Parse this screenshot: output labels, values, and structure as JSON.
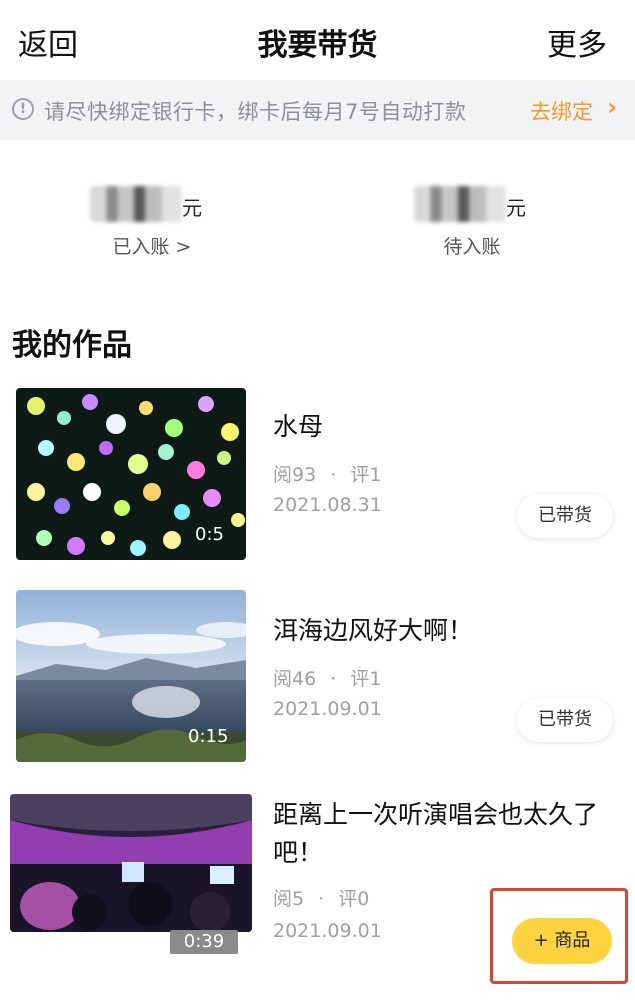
{
  "header": {
    "back_label": "返回",
    "title": "我要带货",
    "more_label": "更多"
  },
  "notice": {
    "icon": "info-circle-icon",
    "message": "请尽快绑定银行卡，绑卡后每月7号自动打款",
    "action_label": "去绑定",
    "accent_color": "#f39b2f"
  },
  "balances": [
    {
      "unit": "元",
      "label": "已入账 >"
    },
    {
      "unit": "元",
      "label": "待入账"
    }
  ],
  "section": {
    "title": "我的作品"
  },
  "works": [
    {
      "title": "水母",
      "views": "阅93",
      "sep": "·",
      "comments": "评1",
      "date": "2021.08.31",
      "duration": "0:5",
      "button_label": "已带货"
    },
    {
      "title": "洱海边风好大啊！",
      "views": "阅46",
      "sep": "·",
      "comments": "评1",
      "date": "2021.09.01",
      "duration": "0:15",
      "button_label": "已带货"
    },
    {
      "title_line1": "距离上一次听演唱会也太久了",
      "title_line2": "吧！",
      "views": "阅5",
      "sep": "·",
      "comments": "评0",
      "date": "2021.09.01",
      "duration": "0:39",
      "button_label": "+ 商品"
    }
  ]
}
